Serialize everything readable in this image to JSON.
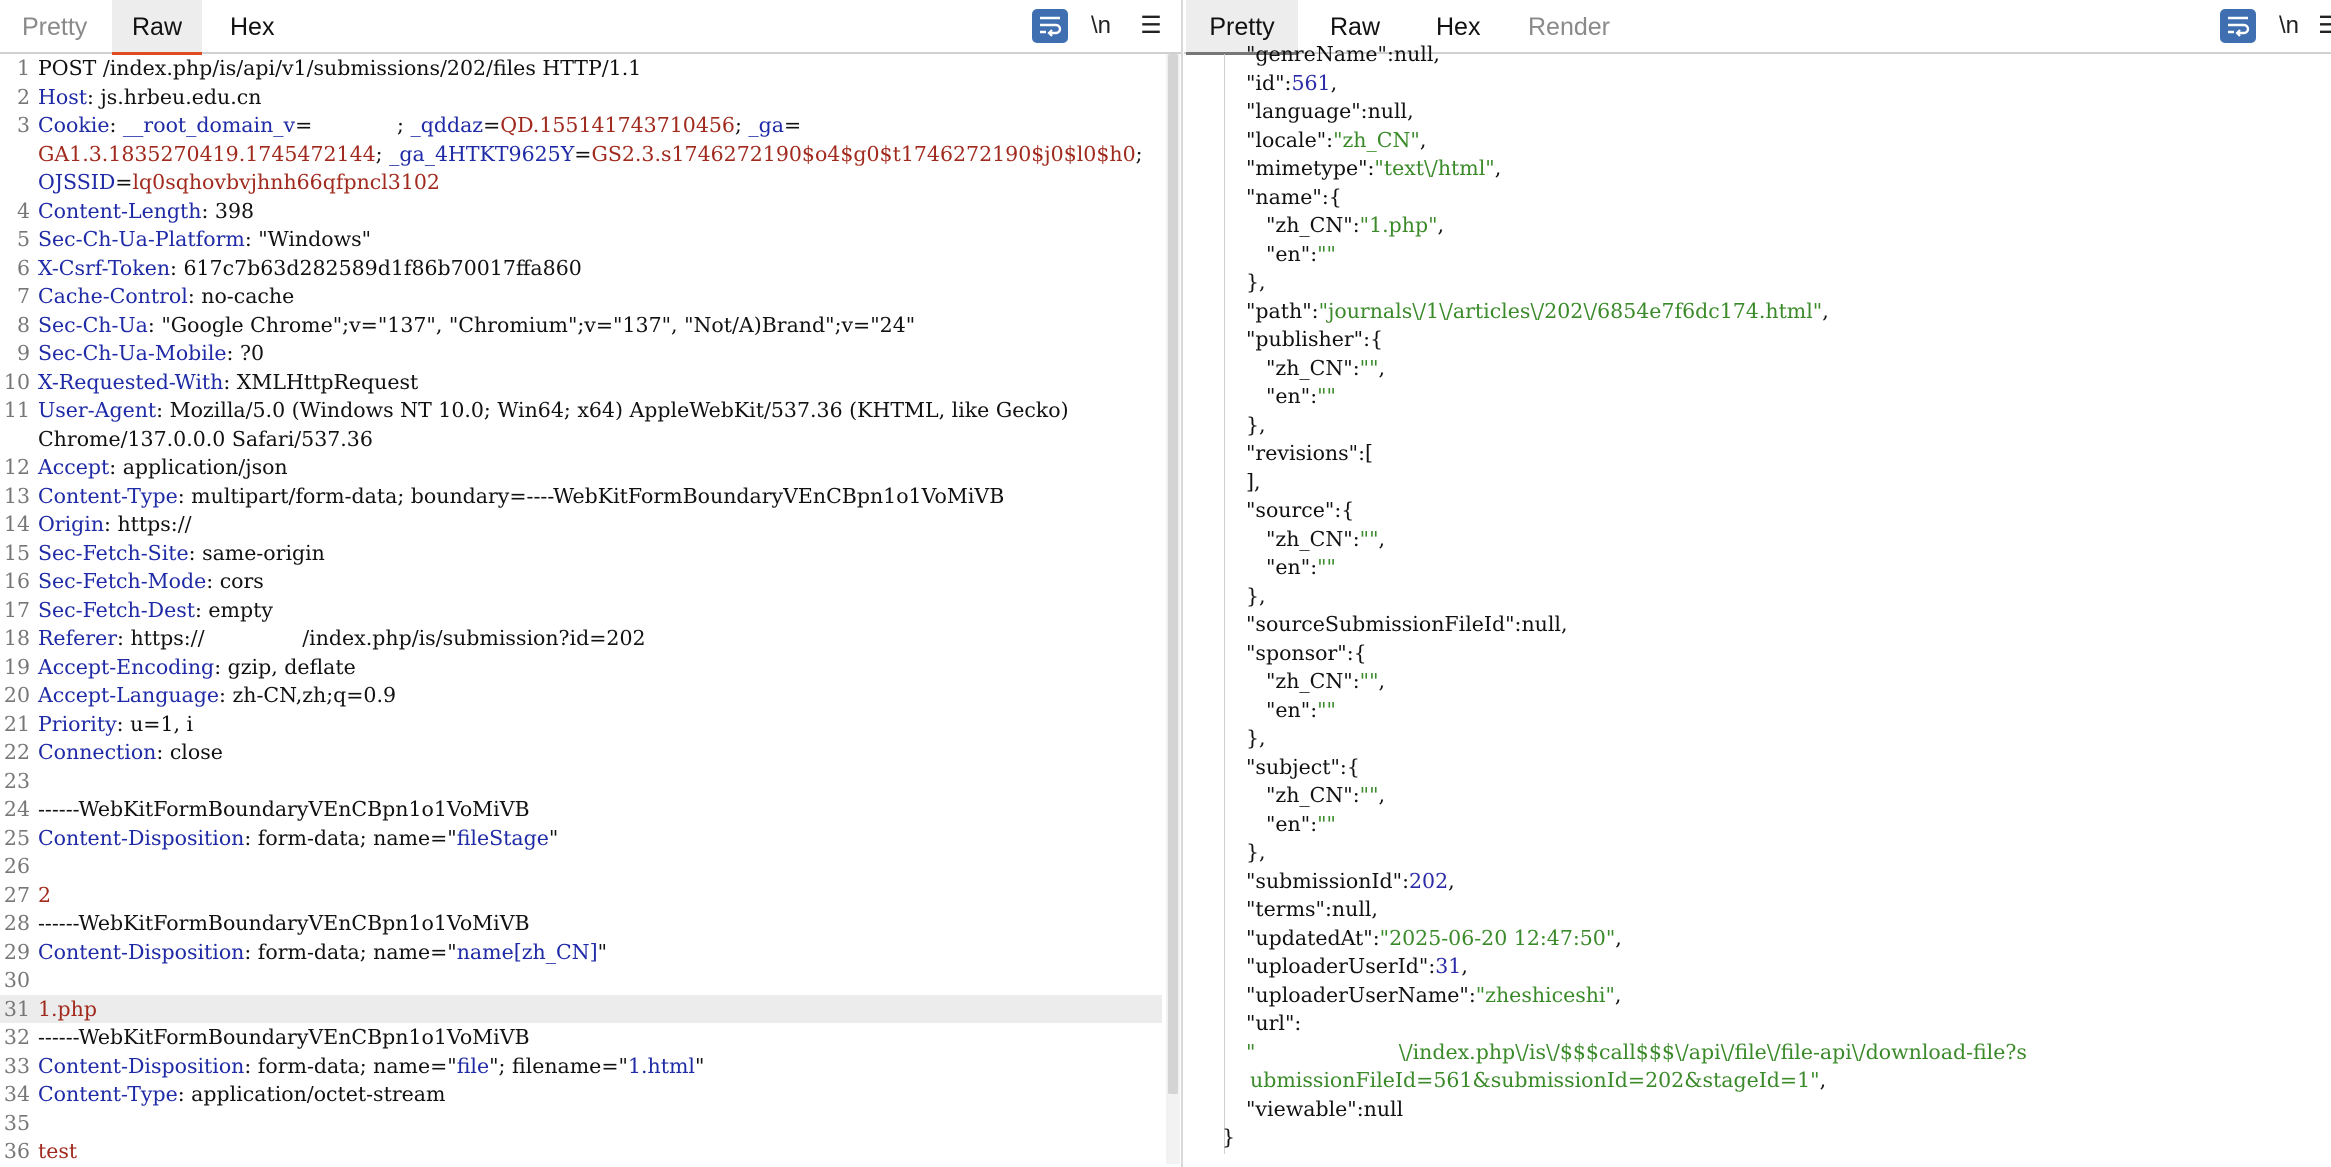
{
  "left": {
    "tabs": [
      {
        "label": "Pretty",
        "state": "inactive"
      },
      {
        "label": "Raw",
        "state": "active"
      },
      {
        "label": "Hex",
        "state": "inactive"
      }
    ],
    "tools": {
      "newline": "\\n",
      "menu": "☰",
      "wrap_icon": "wrap-lines-icon"
    },
    "lines": [
      [
        {
          "t": "POST /index.php/is/api/v1/submissions/202/files HTTP/1.1",
          "c": "p"
        }
      ],
      [
        {
          "t": "Host",
          "c": "k"
        },
        {
          "t": ": js.hrbeu.edu.cn",
          "c": "v"
        }
      ],
      [
        {
          "t": "Cookie",
          "c": "k"
        },
        {
          "t": ": ",
          "c": "v"
        },
        {
          "t": "__root_domain_v",
          "c": "k"
        },
        {
          "t": "=",
          "c": "v"
        },
        {
          "t": "             ; ",
          "c": "v"
        },
        {
          "t": "_qddaz",
          "c": "k"
        },
        {
          "t": "=",
          "c": "v"
        },
        {
          "t": "QD.155141743710456",
          "c": "r"
        },
        {
          "t": "; ",
          "c": "v"
        },
        {
          "t": "_ga",
          "c": "k"
        },
        {
          "t": "=",
          "c": "v"
        }
      ],
      [
        {
          "t": "GA1.3.1835270419.1745472144",
          "c": "r"
        },
        {
          "t": "; ",
          "c": "v"
        },
        {
          "t": "_ga_4HTKT9625Y",
          "c": "k"
        },
        {
          "t": "=",
          "c": "v"
        },
        {
          "t": "GS2.3.s1746272190$o4$g0$t1746272190$j0$l0$h0",
          "c": "r"
        },
        {
          "t": ";",
          "c": "v"
        }
      ],
      [
        {
          "t": "OJSSID",
          "c": "k"
        },
        {
          "t": "=",
          "c": "v"
        },
        {
          "t": "lq0sqhovbvjhnh66qfpncl3102",
          "c": "r"
        }
      ],
      [
        {
          "t": "Content-Length",
          "c": "k"
        },
        {
          "t": ": 398",
          "c": "v"
        }
      ],
      [
        {
          "t": "Sec-Ch-Ua-Platform",
          "c": "k"
        },
        {
          "t": ": \"Windows\"",
          "c": "v"
        }
      ],
      [
        {
          "t": "X-Csrf-Token",
          "c": "k"
        },
        {
          "t": ": 617c7b63d282589d1f86b70017ffa860",
          "c": "v"
        }
      ],
      [
        {
          "t": "Cache-Control",
          "c": "k"
        },
        {
          "t": ": no-cache",
          "c": "v"
        }
      ],
      [
        {
          "t": "Sec-Ch-Ua",
          "c": "k"
        },
        {
          "t": ": \"Google Chrome\";v=\"137\", \"Chromium\";v=\"137\", \"Not/A)Brand\";v=\"24\"",
          "c": "v"
        }
      ],
      [
        {
          "t": "Sec-Ch-Ua-Mobile",
          "c": "k"
        },
        {
          "t": ": ?0",
          "c": "v"
        }
      ],
      [
        {
          "t": "X-Requested-With",
          "c": "k"
        },
        {
          "t": ": XMLHttpRequest",
          "c": "v"
        }
      ],
      [
        {
          "t": "User-Agent",
          "c": "k"
        },
        {
          "t": ": Mozilla/5.0 (Windows NT 10.0; Win64; x64) AppleWebKit/537.36 (KHTML, like Gecko)",
          "c": "v"
        }
      ],
      [
        {
          "t": "Chrome/137.0.0.0 Safari/537.36",
          "c": "v"
        }
      ],
      [
        {
          "t": "Accept",
          "c": "k"
        },
        {
          "t": ": application/json",
          "c": "v"
        }
      ],
      [
        {
          "t": "Content-Type",
          "c": "k"
        },
        {
          "t": ": multipart/form-data; boundary=----WebKitFormBoundaryVEnCBpn1o1VoMiVB",
          "c": "v"
        }
      ],
      [
        {
          "t": "Origin",
          "c": "k"
        },
        {
          "t": ": https://",
          "c": "v"
        }
      ],
      [
        {
          "t": "Sec-Fetch-Site",
          "c": "k"
        },
        {
          "t": ": same-origin",
          "c": "v"
        }
      ],
      [
        {
          "t": "Sec-Fetch-Mode",
          "c": "k"
        },
        {
          "t": ": cors",
          "c": "v"
        }
      ],
      [
        {
          "t": "Sec-Fetch-Dest",
          "c": "k"
        },
        {
          "t": ": empty",
          "c": "v"
        }
      ],
      [
        {
          "t": "Referer",
          "c": "k"
        },
        {
          "t": ": https://               /index.php/is/submission?id=202",
          "c": "v"
        }
      ],
      [
        {
          "t": "Accept-Encoding",
          "c": "k"
        },
        {
          "t": ": gzip, deflate",
          "c": "v"
        }
      ],
      [
        {
          "t": "Accept-Language",
          "c": "k"
        },
        {
          "t": ": zh-CN,zh;q=0.9",
          "c": "v"
        }
      ],
      [
        {
          "t": "Priority",
          "c": "k"
        },
        {
          "t": ": u=1, i",
          "c": "v"
        }
      ],
      [
        {
          "t": "Connection",
          "c": "k"
        },
        {
          "t": ": close",
          "c": "v"
        }
      ],
      [],
      [
        {
          "t": "------WebKitFormBoundaryVEnCBpn1o1VoMiVB",
          "c": "v"
        }
      ],
      [
        {
          "t": "Content-Disposition",
          "c": "k"
        },
        {
          "t": ": form-data; name=\"",
          "c": "v"
        },
        {
          "t": "fileStage",
          "c": "b"
        },
        {
          "t": "\"",
          "c": "v"
        }
      ],
      [],
      [
        {
          "t": "2",
          "c": "r"
        }
      ],
      [
        {
          "t": "------WebKitFormBoundaryVEnCBpn1o1VoMiVB",
          "c": "v"
        }
      ],
      [
        {
          "t": "Content-Disposition",
          "c": "k"
        },
        {
          "t": ": form-data; name=\"",
          "c": "v"
        },
        {
          "t": "name[zh_CN]",
          "c": "b"
        },
        {
          "t": "\"",
          "c": "v"
        }
      ],
      [],
      [
        {
          "t": "1.php",
          "c": "r"
        }
      ],
      [
        {
          "t": "------WebKitFormBoundaryVEnCBpn1o1VoMiVB",
          "c": "v"
        }
      ],
      [
        {
          "t": "Content-Disposition",
          "c": "k"
        },
        {
          "t": ": form-data; name=\"",
          "c": "v"
        },
        {
          "t": "file",
          "c": "b"
        },
        {
          "t": "\"; filename=\"",
          "c": "v"
        },
        {
          "t": "1.html",
          "c": "b"
        },
        {
          "t": "\"",
          "c": "v"
        }
      ],
      [
        {
          "t": "Content-Type",
          "c": "k"
        },
        {
          "t": ": application/octet-stream",
          "c": "v"
        }
      ],
      [],
      [
        {
          "t": "test",
          "c": "r"
        }
      ]
    ],
    "line_numbers": [
      "1",
      "2",
      "3",
      "",
      "",
      "4",
      "5",
      "6",
      "7",
      "8",
      "9",
      "10",
      "11",
      "",
      "12",
      "13",
      "14",
      "15",
      "16",
      "17",
      "18",
      "19",
      "20",
      "21",
      "22",
      "23",
      "24",
      "25",
      "26",
      "27",
      "28",
      "29",
      "30",
      "31",
      "32",
      "33",
      "34",
      "35",
      "36"
    ],
    "highlighted_line": "31"
  },
  "right": {
    "tabs": [
      {
        "label": "Pretty",
        "state": "active"
      },
      {
        "label": "Raw",
        "state": "inactive"
      },
      {
        "label": "Hex",
        "state": "inactive"
      },
      {
        "label": "Render",
        "state": "disabled"
      }
    ],
    "tools": {
      "newline": "\\n",
      "menu": "☰",
      "wrap_icon": "wrap-lines-icon"
    },
    "lines": [
      {
        "i": 1,
        "s": [
          {
            "t": "\"genreName\"",
            "c": "p"
          },
          {
            "t": ":null,",
            "c": "p"
          }
        ]
      },
      {
        "i": 1,
        "s": [
          {
            "t": "\"id\"",
            "c": "p"
          },
          {
            "t": ":",
            "c": "p"
          },
          {
            "t": "561",
            "c": "n"
          },
          {
            "t": ",",
            "c": "p"
          }
        ]
      },
      {
        "i": 1,
        "s": [
          {
            "t": "\"language\"",
            "c": "p"
          },
          {
            "t": ":null,",
            "c": "p"
          }
        ]
      },
      {
        "i": 1,
        "s": [
          {
            "t": "\"locale\"",
            "c": "p"
          },
          {
            "t": ":",
            "c": "p"
          },
          {
            "t": "\"zh_CN\"",
            "c": "g"
          },
          {
            "t": ",",
            "c": "p"
          }
        ]
      },
      {
        "i": 1,
        "s": [
          {
            "t": "\"mimetype\"",
            "c": "p"
          },
          {
            "t": ":",
            "c": "p"
          },
          {
            "t": "\"text\\/html\"",
            "c": "g"
          },
          {
            "t": ",",
            "c": "p"
          }
        ]
      },
      {
        "i": 1,
        "s": [
          {
            "t": "\"name\"",
            "c": "p"
          },
          {
            "t": ":{",
            "c": "p"
          }
        ]
      },
      {
        "i": 2,
        "s": [
          {
            "t": "\"zh_CN\"",
            "c": "p"
          },
          {
            "t": ":",
            "c": "p"
          },
          {
            "t": "\"1.php\"",
            "c": "g"
          },
          {
            "t": ",",
            "c": "p"
          }
        ]
      },
      {
        "i": 2,
        "s": [
          {
            "t": "\"en\"",
            "c": "p"
          },
          {
            "t": ":",
            "c": "p"
          },
          {
            "t": "\"\"",
            "c": "g"
          }
        ]
      },
      {
        "i": 1,
        "s": [
          {
            "t": "},",
            "c": "p"
          }
        ]
      },
      {
        "i": 1,
        "s": [
          {
            "t": "\"path\"",
            "c": "p"
          },
          {
            "t": ":",
            "c": "p"
          },
          {
            "t": "\"journals\\/1\\/articles\\/202\\/6854e7f6dc174.html\"",
            "c": "g"
          },
          {
            "t": ",",
            "c": "p"
          }
        ]
      },
      {
        "i": 1,
        "s": [
          {
            "t": "\"publisher\"",
            "c": "p"
          },
          {
            "t": ":{",
            "c": "p"
          }
        ]
      },
      {
        "i": 2,
        "s": [
          {
            "t": "\"zh_CN\"",
            "c": "p"
          },
          {
            "t": ":",
            "c": "p"
          },
          {
            "t": "\"\"",
            "c": "g"
          },
          {
            "t": ",",
            "c": "p"
          }
        ]
      },
      {
        "i": 2,
        "s": [
          {
            "t": "\"en\"",
            "c": "p"
          },
          {
            "t": ":",
            "c": "p"
          },
          {
            "t": "\"\"",
            "c": "g"
          }
        ]
      },
      {
        "i": 1,
        "s": [
          {
            "t": "},",
            "c": "p"
          }
        ]
      },
      {
        "i": 1,
        "s": [
          {
            "t": "\"revisions\"",
            "c": "p"
          },
          {
            "t": ":[",
            "c": "p"
          }
        ]
      },
      {
        "i": 1,
        "s": [
          {
            "t": "],",
            "c": "p"
          }
        ]
      },
      {
        "i": 1,
        "s": [
          {
            "t": "\"source\"",
            "c": "p"
          },
          {
            "t": ":{",
            "c": "p"
          }
        ]
      },
      {
        "i": 2,
        "s": [
          {
            "t": "\"zh_CN\"",
            "c": "p"
          },
          {
            "t": ":",
            "c": "p"
          },
          {
            "t": "\"\"",
            "c": "g"
          },
          {
            "t": ",",
            "c": "p"
          }
        ]
      },
      {
        "i": 2,
        "s": [
          {
            "t": "\"en\"",
            "c": "p"
          },
          {
            "t": ":",
            "c": "p"
          },
          {
            "t": "\"\"",
            "c": "g"
          }
        ]
      },
      {
        "i": 1,
        "s": [
          {
            "t": "},",
            "c": "p"
          }
        ]
      },
      {
        "i": 1,
        "s": [
          {
            "t": "\"sourceSubmissionFileId\"",
            "c": "p"
          },
          {
            "t": ":null,",
            "c": "p"
          }
        ]
      },
      {
        "i": 1,
        "s": [
          {
            "t": "\"sponsor\"",
            "c": "p"
          },
          {
            "t": ":{",
            "c": "p"
          }
        ]
      },
      {
        "i": 2,
        "s": [
          {
            "t": "\"zh_CN\"",
            "c": "p"
          },
          {
            "t": ":",
            "c": "p"
          },
          {
            "t": "\"\"",
            "c": "g"
          },
          {
            "t": ",",
            "c": "p"
          }
        ]
      },
      {
        "i": 2,
        "s": [
          {
            "t": "\"en\"",
            "c": "p"
          },
          {
            "t": ":",
            "c": "p"
          },
          {
            "t": "\"\"",
            "c": "g"
          }
        ]
      },
      {
        "i": 1,
        "s": [
          {
            "t": "},",
            "c": "p"
          }
        ]
      },
      {
        "i": 1,
        "s": [
          {
            "t": "\"subject\"",
            "c": "p"
          },
          {
            "t": ":{",
            "c": "p"
          }
        ]
      },
      {
        "i": 2,
        "s": [
          {
            "t": "\"zh_CN\"",
            "c": "p"
          },
          {
            "t": ":",
            "c": "p"
          },
          {
            "t": "\"\"",
            "c": "g"
          },
          {
            "t": ",",
            "c": "p"
          }
        ]
      },
      {
        "i": 2,
        "s": [
          {
            "t": "\"en\"",
            "c": "p"
          },
          {
            "t": ":",
            "c": "p"
          },
          {
            "t": "\"\"",
            "c": "g"
          }
        ]
      },
      {
        "i": 1,
        "s": [
          {
            "t": "},",
            "c": "p"
          }
        ]
      },
      {
        "i": 1,
        "s": [
          {
            "t": "\"submissionId\"",
            "c": "p"
          },
          {
            "t": ":",
            "c": "p"
          },
          {
            "t": "202",
            "c": "n"
          },
          {
            "t": ",",
            "c": "p"
          }
        ]
      },
      {
        "i": 1,
        "s": [
          {
            "t": "\"terms\"",
            "c": "p"
          },
          {
            "t": ":null,",
            "c": "p"
          }
        ]
      },
      {
        "i": 1,
        "s": [
          {
            "t": "\"updatedAt\"",
            "c": "p"
          },
          {
            "t": ":",
            "c": "p"
          },
          {
            "t": "\"2025-06-20 12:47:50\"",
            "c": "g"
          },
          {
            "t": ",",
            "c": "p"
          }
        ]
      },
      {
        "i": 1,
        "s": [
          {
            "t": "\"uploaderUserId\"",
            "c": "p"
          },
          {
            "t": ":",
            "c": "p"
          },
          {
            "t": "31",
            "c": "n"
          },
          {
            "t": ",",
            "c": "p"
          }
        ]
      },
      {
        "i": 1,
        "s": [
          {
            "t": "\"uploaderUserName\"",
            "c": "p"
          },
          {
            "t": ":",
            "c": "p"
          },
          {
            "t": "\"zheshiceshi\"",
            "c": "g"
          },
          {
            "t": ",",
            "c": "p"
          }
        ]
      },
      {
        "i": 1,
        "s": [
          {
            "t": "\"url\"",
            "c": "p"
          },
          {
            "t": ":",
            "c": "p"
          }
        ]
      },
      {
        "i": 1,
        "s": [
          {
            "t": "\"                      \\/index.php\\/is\\/$$$call$$$\\/api\\/file\\/file-api\\/download-file?s",
            "c": "g"
          }
        ]
      },
      {
        "i": 0,
        "s": [
          {
            "t": "ubmissionFileId=561&submissionId=202&stageId=1\"",
            "c": "g"
          },
          {
            "t": ",",
            "c": "p"
          }
        ]
      },
      {
        "i": 1,
        "s": [
          {
            "t": "\"viewable\"",
            "c": "p"
          },
          {
            "t": ":null",
            "c": "p"
          }
        ]
      },
      {
        "i": -1,
        "s": [
          {
            "t": "}",
            "c": "p"
          }
        ]
      }
    ]
  }
}
